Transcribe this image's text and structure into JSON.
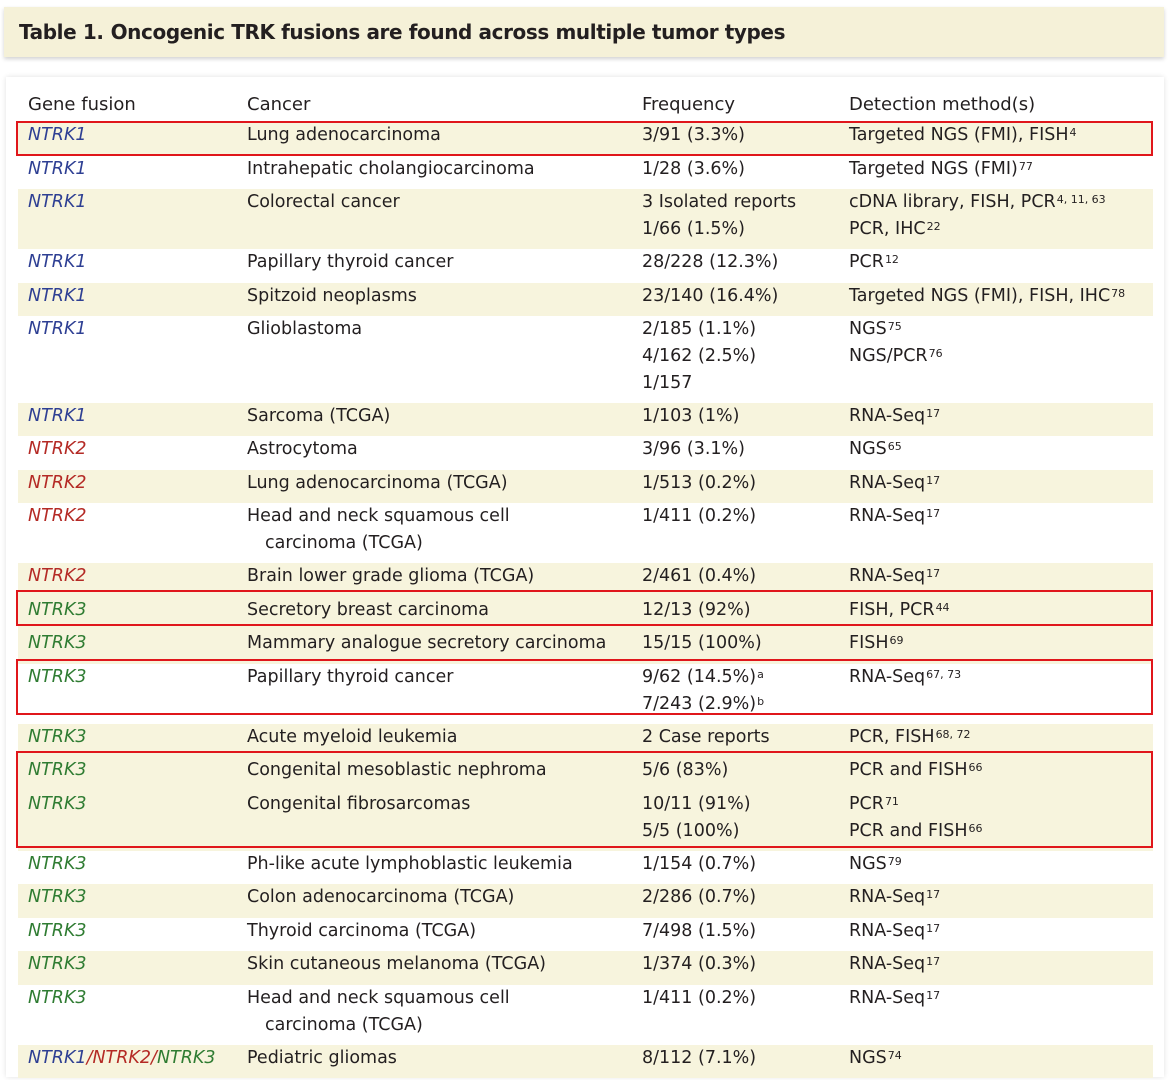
{
  "title": {
    "label": "Table 1.",
    "text": "Oncogenic TRK fusions are found across multiple tumor types"
  },
  "headers": [
    "Gene fusion",
    "Cancer",
    "Frequency",
    "Detection method(s)"
  ],
  "rows": [
    {
      "gene": "NTRK1",
      "cancer": [
        "Lung adenocarcinoma"
      ],
      "freq": [
        "3/91 (3.3%)"
      ],
      "method": [
        {
          "t": "Targeted NGS (FMI), FISH",
          "s": "4"
        }
      ]
    },
    {
      "gene": "NTRK1",
      "cancer": [
        "Intrahepatic cholangiocarcinoma"
      ],
      "freq": [
        "1/28 (3.6%)"
      ],
      "method": [
        {
          "t": "Targeted NGS (FMI)",
          "s": "77"
        }
      ]
    },
    {
      "gene": "NTRK1",
      "cancer": [
        "Colorectal cancer"
      ],
      "freq": [
        "3 Isolated reports",
        "1/66 (1.5%)"
      ],
      "method": [
        {
          "t": "cDNA library, FISH, PCR",
          "s": "4, 11, 63"
        },
        {
          "t": "PCR, IHC",
          "s": "22"
        }
      ]
    },
    {
      "gene": "NTRK1",
      "cancer": [
        "Papillary thyroid cancer"
      ],
      "freq": [
        "28/228 (12.3%)"
      ],
      "method": [
        {
          "t": "PCR",
          "s": "12"
        }
      ]
    },
    {
      "gene": "NTRK1",
      "cancer": [
        "Spitzoid neoplasms"
      ],
      "freq": [
        "23/140 (16.4%)"
      ],
      "method": [
        {
          "t": "Targeted NGS (FMI), FISH, IHC",
          "s": "78"
        }
      ]
    },
    {
      "gene": "NTRK1",
      "cancer": [
        "Glioblastoma"
      ],
      "freq": [
        "2/185 (1.1%)",
        "4/162 (2.5%)",
        "1/157"
      ],
      "method": [
        {
          "t": "NGS",
          "s": "75"
        },
        {
          "t": "NGS/PCR",
          "s": "76"
        }
      ]
    },
    {
      "gene": "NTRK1",
      "cancer": [
        "Sarcoma (TCGA)"
      ],
      "freq": [
        "1/103 (1%)"
      ],
      "method": [
        {
          "t": "RNA-Seq",
          "s": "17"
        }
      ]
    },
    {
      "gene": "NTRK2",
      "cancer": [
        "Astrocytoma"
      ],
      "freq": [
        "3/96 (3.1%)"
      ],
      "method": [
        {
          "t": "NGS",
          "s": "65"
        }
      ]
    },
    {
      "gene": "NTRK2",
      "cancer": [
        "Lung adenocarcinoma (TCGA)"
      ],
      "freq": [
        "1/513 (0.2%)"
      ],
      "method": [
        {
          "t": "RNA-Seq",
          "s": "17"
        }
      ]
    },
    {
      "gene": "NTRK2",
      "cancer": [
        "Head and neck squamous cell",
        "carcinoma (TCGA)"
      ],
      "freq": [
        "1/411 (0.2%)"
      ],
      "method": [
        {
          "t": "RNA-Seq",
          "s": "17"
        }
      ]
    },
    {
      "gene": "NTRK2",
      "cancer": [
        "Brain lower grade glioma (TCGA)"
      ],
      "freq": [
        "2/461 (0.4%)"
      ],
      "method": [
        {
          "t": "RNA-Seq",
          "s": "17"
        }
      ]
    },
    {
      "gene": "NTRK3",
      "cancer": [
        "Secretory breast carcinoma"
      ],
      "freq": [
        "12/13 (92%)"
      ],
      "method": [
        {
          "t": "FISH, PCR",
          "s": "44"
        }
      ]
    },
    {
      "gene": "NTRK3",
      "cancer": [
        "Mammary analogue secretory carcinoma"
      ],
      "freq": [
        "15/15 (100%)"
      ],
      "method": [
        {
          "t": "FISH",
          "s": "69"
        }
      ]
    },
    {
      "gene": "NTRK3",
      "cancer": [
        "Papillary thyroid cancer"
      ],
      "freq": [
        "9/62 (14.5%)|a",
        "7/243 (2.9%)|b"
      ],
      "method": [
        {
          "t": "RNA-Seq",
          "s": "67, 73"
        }
      ]
    },
    {
      "gene": "NTRK3",
      "cancer": [
        "Acute myeloid leukemia"
      ],
      "freq": [
        "2 Case reports"
      ],
      "method": [
        {
          "t": "PCR, FISH",
          "s": "68, 72"
        }
      ]
    },
    {
      "gene": "NTRK3",
      "cancer": [
        "Congenital mesoblastic nephroma"
      ],
      "freq": [
        "5/6 (83%)"
      ],
      "method": [
        {
          "t": "PCR and FISH",
          "s": "66"
        }
      ]
    },
    {
      "gene": "NTRK3",
      "cancer": [
        "Congenital fibrosarcomas"
      ],
      "freq": [
        "10/11 (91%)",
        "5/5 (100%)"
      ],
      "method": [
        {
          "t": "PCR",
          "s": "71"
        },
        {
          "t": "PCR and FISH",
          "s": "66"
        }
      ]
    },
    {
      "gene": "NTRK3",
      "cancer": [
        "Ph-like acute lymphoblastic leukemia"
      ],
      "freq": [
        "1/154 (0.7%)"
      ],
      "method": [
        {
          "t": "NGS",
          "s": "79"
        }
      ]
    },
    {
      "gene": "NTRK3",
      "cancer": [
        "Colon adenocarcinoma (TCGA)"
      ],
      "freq": [
        "2/286 (0.7%)"
      ],
      "method": [
        {
          "t": "RNA-Seq",
          "s": "17"
        }
      ]
    },
    {
      "gene": "NTRK3",
      "cancer": [
        "Thyroid carcinoma (TCGA)"
      ],
      "freq": [
        "7/498 (1.5%)"
      ],
      "method": [
        {
          "t": "RNA-Seq",
          "s": "17"
        }
      ]
    },
    {
      "gene": "NTRK3",
      "cancer": [
        "Skin cutaneous melanoma (TCGA)"
      ],
      "freq": [
        "1/374 (0.3%)"
      ],
      "method": [
        {
          "t": "RNA-Seq",
          "s": "17"
        }
      ]
    },
    {
      "gene": "NTRK3",
      "cancer": [
        "Head and neck squamous cell",
        "carcinoma (TCGA)"
      ],
      "freq": [
        "1/411 (0.2%)"
      ],
      "method": [
        {
          "t": "RNA-Seq",
          "s": "17"
        }
      ]
    },
    {
      "gene": "NTRK1/NTRK2/NTRK3",
      "cancer": [
        "Pediatric gliomas"
      ],
      "freq": [
        "8/112 (7.1%)"
      ],
      "method": [
        {
          "t": "NGS",
          "s": "74"
        }
      ]
    }
  ],
  "colors": {
    "ntrk1": "#2e3f93",
    "ntrk2": "#b42a25",
    "ntrk3": "#2f7c32",
    "shade": "#f7f4dd",
    "highlight": "#e0161b"
  }
}
